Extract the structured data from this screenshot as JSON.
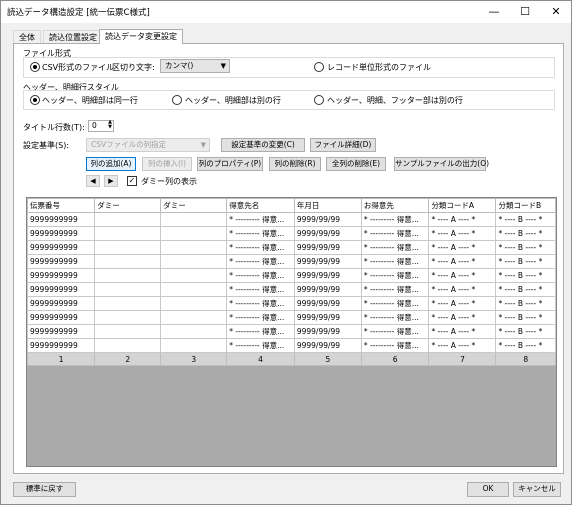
{
  "window": {
    "title": "読込データ構造設定 [統一伝票C様式]",
    "minimize": "—",
    "maximize": "☐",
    "close": "✕"
  },
  "tabs": [
    {
      "label": "全体",
      "active": false
    },
    {
      "label": "読込位置設定",
      "active": false
    },
    {
      "label": "読込データ変更設定",
      "active": true
    }
  ],
  "file_format": {
    "label": "ファイル形式",
    "options": [
      {
        "label": "CSV形式のファイル",
        "selected": true
      },
      {
        "label": "レコード単位形式のファイル",
        "selected": false
      }
    ],
    "delimiter_label": "区切り文字:",
    "delimiter_value": "カンマ()"
  },
  "header_style": {
    "label": "ヘッダー、明細行スタイル",
    "options": [
      {
        "label": "ヘッダー、明細部は同一行",
        "selected": true
      },
      {
        "label": "ヘッダー、明細部は別の行",
        "selected": false
      },
      {
        "label": "ヘッダー、明細、フッター部は別の行",
        "selected": false
      }
    ]
  },
  "title_rows": {
    "label": "タイトル行数(T):",
    "value": "0"
  },
  "setting_basis": {
    "label": "設定基準(S):",
    "value": "CSVファイルの列指定",
    "change_button": "設定基準の変更(C)",
    "file_detail_button": "ファイル詳細(D)"
  },
  "column_buttons": {
    "add": "列の追加(A)",
    "insert": "列の挿入(I)",
    "properties": "列のプロパティ(P)",
    "delete": "列の削除(R)",
    "delete_all": "全列の削除(E)",
    "sample_output": "サンプルファイルの出力(O)"
  },
  "nav": {
    "left": "◀",
    "right": "▶",
    "show_dummy_checked": "✓",
    "show_dummy_label": "ダミー列の表示"
  },
  "grid": {
    "headers": [
      "伝票番号",
      "ダミー",
      "ダミー",
      "得意先名",
      "年月日",
      "お得意先",
      "分類コードA",
      "分類コードB"
    ],
    "rows": [
      [
        "9999999999",
        "",
        "",
        "* --------- 得意...",
        "9999/99/99",
        "* --------- 得意...",
        "* ---- A ---- *",
        "* ---- B ---- *"
      ],
      [
        "9999999999",
        "",
        "",
        "* --------- 得意...",
        "9999/99/99",
        "* --------- 得意...",
        "* ---- A ---- *",
        "* ---- B ---- *"
      ],
      [
        "9999999999",
        "",
        "",
        "* --------- 得意...",
        "9999/99/99",
        "* --------- 得意...",
        "* ---- A ---- *",
        "* ---- B ---- *"
      ],
      [
        "9999999999",
        "",
        "",
        "* --------- 得意...",
        "9999/99/99",
        "* --------- 得意...",
        "* ---- A ---- *",
        "* ---- B ---- *"
      ],
      [
        "9999999999",
        "",
        "",
        "* --------- 得意...",
        "9999/99/99",
        "* --------- 得意...",
        "* ---- A ---- *",
        "* ---- B ---- *"
      ],
      [
        "9999999999",
        "",
        "",
        "* --------- 得意...",
        "9999/99/99",
        "* --------- 得意...",
        "* ---- A ---- *",
        "* ---- B ---- *"
      ],
      [
        "9999999999",
        "",
        "",
        "* --------- 得意...",
        "9999/99/99",
        "* --------- 得意...",
        "* ---- A ---- *",
        "* ---- B ---- *"
      ],
      [
        "9999999999",
        "",
        "",
        "* --------- 得意...",
        "9999/99/99",
        "* --------- 得意...",
        "* ---- A ---- *",
        "* ---- B ---- *"
      ],
      [
        "9999999999",
        "",
        "",
        "* --------- 得意...",
        "9999/99/99",
        "* --------- 得意...",
        "* ---- A ---- *",
        "* ---- B ---- *"
      ],
      [
        "9999999999",
        "",
        "",
        "* --------- 得意...",
        "9999/99/99",
        "* --------- 得意...",
        "* ---- A ---- *",
        "* ---- B ---- *"
      ]
    ],
    "column_numbers": [
      "1",
      "2",
      "3",
      "4",
      "5",
      "6",
      "7",
      "8"
    ]
  },
  "footer": {
    "reset": "標準に戻す",
    "ok": "OK",
    "cancel": "キャンセル"
  }
}
